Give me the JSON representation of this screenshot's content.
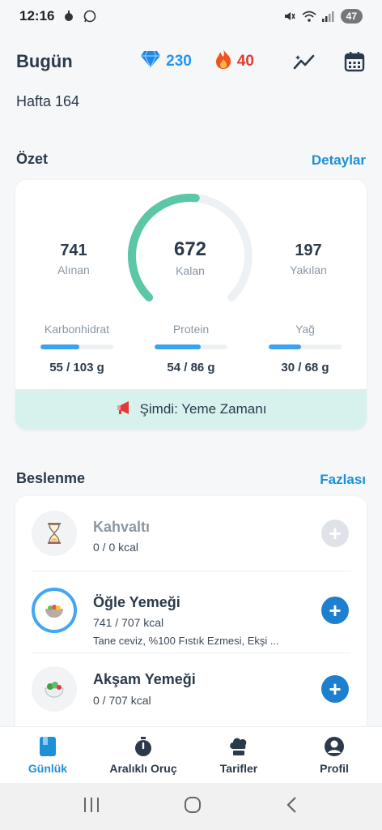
{
  "status": {
    "time": "12:16",
    "battery": "47"
  },
  "header": {
    "title": "Bugün",
    "gems": "230",
    "streak": "40",
    "week": "Hafta 164"
  },
  "summary": {
    "title": "Özet",
    "link": "Detaylar",
    "eaten": {
      "value": "741",
      "label": "Alınan"
    },
    "remaining": {
      "value": "672",
      "label": "Kalan"
    },
    "burned": {
      "value": "197",
      "label": "Yakılan"
    },
    "gauge_progress": 0.52,
    "macros": [
      {
        "name": "Karbonhidrat",
        "value": "55 / 103 g",
        "progress": 0.53
      },
      {
        "name": "Protein",
        "value": "54 / 86 g",
        "progress": 0.63
      },
      {
        "name": "Yağ",
        "value": "30 / 68 g",
        "progress": 0.44
      }
    ],
    "banner": "Şimdi: Yeme Zamanı"
  },
  "nutrition": {
    "title": "Beslenme",
    "link": "Fazlası",
    "meals": [
      {
        "name": "Kahvaltı",
        "kcal": "0 / 0 kcal",
        "desc": ""
      },
      {
        "name": "Öğle Yemeği",
        "kcal": "741 / 707 kcal",
        "desc": "Tane ceviz, %100 Fıstık Ezmesi, Ekşi ..."
      },
      {
        "name": "Akşam Yemeği",
        "kcal": "0 / 707 kcal",
        "desc": ""
      }
    ]
  },
  "nav": [
    {
      "label": "Günlük"
    },
    {
      "label": "Aralıklı Oruç"
    },
    {
      "label": "Tarifler"
    },
    {
      "label": "Profil"
    }
  ],
  "colors": {
    "accent": "#1e90d6",
    "gauge": "#5cc7a6",
    "macro_bar": "#3ba3ee",
    "banner": "#d7f2ec",
    "fire": "#e53935"
  }
}
